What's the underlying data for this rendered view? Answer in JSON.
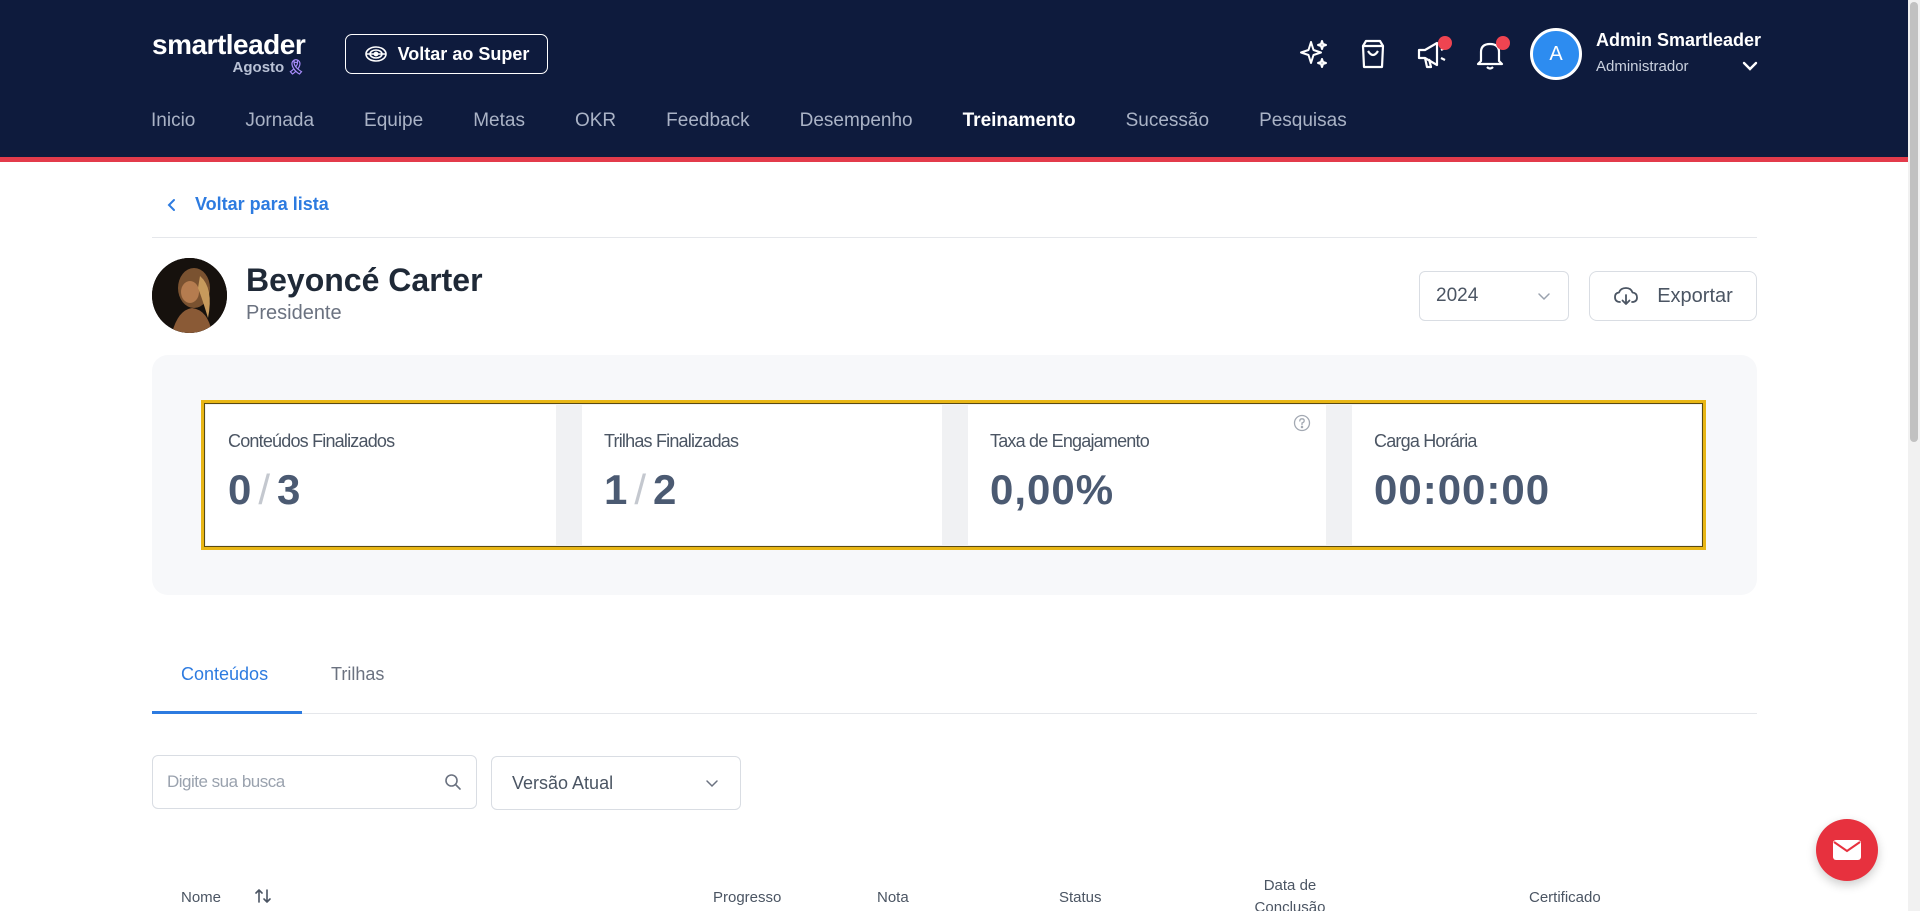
{
  "header": {
    "brand_name": "smartleader",
    "brand_sub": "Agosto",
    "back_super_label": "Voltar ao Super",
    "user": {
      "avatar_letter": "A",
      "name": "Admin Smartleader",
      "role": "Administrador"
    },
    "nav": [
      {
        "label": "Inicio",
        "active": false
      },
      {
        "label": "Jornada",
        "active": false
      },
      {
        "label": "Equipe",
        "active": false
      },
      {
        "label": "Metas",
        "active": false
      },
      {
        "label": "OKR",
        "active": false
      },
      {
        "label": "Feedback",
        "active": false
      },
      {
        "label": "Desempenho",
        "active": false
      },
      {
        "label": "Treinamento",
        "active": true
      },
      {
        "label": "Sucessão",
        "active": false
      },
      {
        "label": "Pesquisas",
        "active": false
      }
    ],
    "colors": {
      "background": "#0e1b3d",
      "accent_border": "#e33b4b",
      "notification_dot": "#ef4451"
    }
  },
  "page": {
    "back_label": "Voltar para lista",
    "profile": {
      "name": "Beyoncé Carter",
      "role": "Presidente"
    },
    "year": "2024",
    "export_label": "Exportar",
    "stats": [
      {
        "label": "Conteúdos Finalizados",
        "done": "0",
        "total": "3"
      },
      {
        "label": "Trilhas Finalizadas",
        "done": "1",
        "total": "2"
      },
      {
        "label": "Taxa de Engajamento",
        "value": "0,00%"
      },
      {
        "label": "Carga Horária",
        "value": "00:00:00"
      }
    ],
    "tabs": [
      {
        "label": "Conteúdos",
        "active": true
      },
      {
        "label": "Trilhas",
        "active": false
      }
    ],
    "search": {
      "placeholder": "Digite sua busca",
      "value": ""
    },
    "version_select": "Versão Atual",
    "table_headers": {
      "name": "Nome",
      "progress": "Progresso",
      "grade": "Nota",
      "status": "Status",
      "completion_date": "Data de Conclusão",
      "certificate": "Certificado"
    },
    "colors": {
      "link": "#2d7be0",
      "highlight_border": "#e8b615",
      "fab": "#e7313e"
    }
  }
}
